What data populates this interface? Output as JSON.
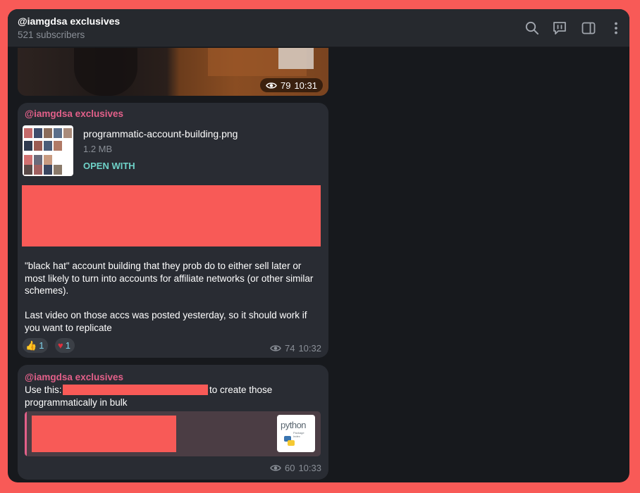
{
  "header": {
    "title": "@iamgdsa exclusives",
    "subtitle": "521 subscribers",
    "buttons": [
      "search-icon",
      "discussion-icon",
      "sidebar-toggle-icon",
      "more-icon"
    ]
  },
  "media_message": {
    "views": "79",
    "time": "10:31"
  },
  "post1": {
    "author": "@iamgdsa exclusives",
    "file": {
      "name": "programmatic-account-building.png",
      "size": "1.2 MB",
      "action": "OPEN WITH"
    },
    "paragraph1": "\"black hat\" account building that they prob do to either sell later or most likely to turn into accounts for affiliate networks (or other similar schemes).",
    "paragraph2": "Last video on those accs was posted yesterday, so it should work if you want to replicate",
    "reactions": [
      {
        "emoji": "👍",
        "count": "1"
      },
      {
        "emoji": "♥",
        "count": "1"
      }
    ],
    "views": "74",
    "time": "10:32"
  },
  "post2": {
    "author": "@iamgdsa exclusives",
    "text_before": "Use this:",
    "text_after": "to create those",
    "text_line2": "programmatically in bulk",
    "preview_logo": {
      "title": "python",
      "subtitle_line1": "Package",
      "subtitle_line2": "Index"
    },
    "views": "60",
    "time": "10:33"
  },
  "colors": {
    "frame": "#f85a57",
    "author": "#e3608a",
    "link_action": "#6ed2c8",
    "bubble": "#292c33",
    "background": "#17191d"
  }
}
